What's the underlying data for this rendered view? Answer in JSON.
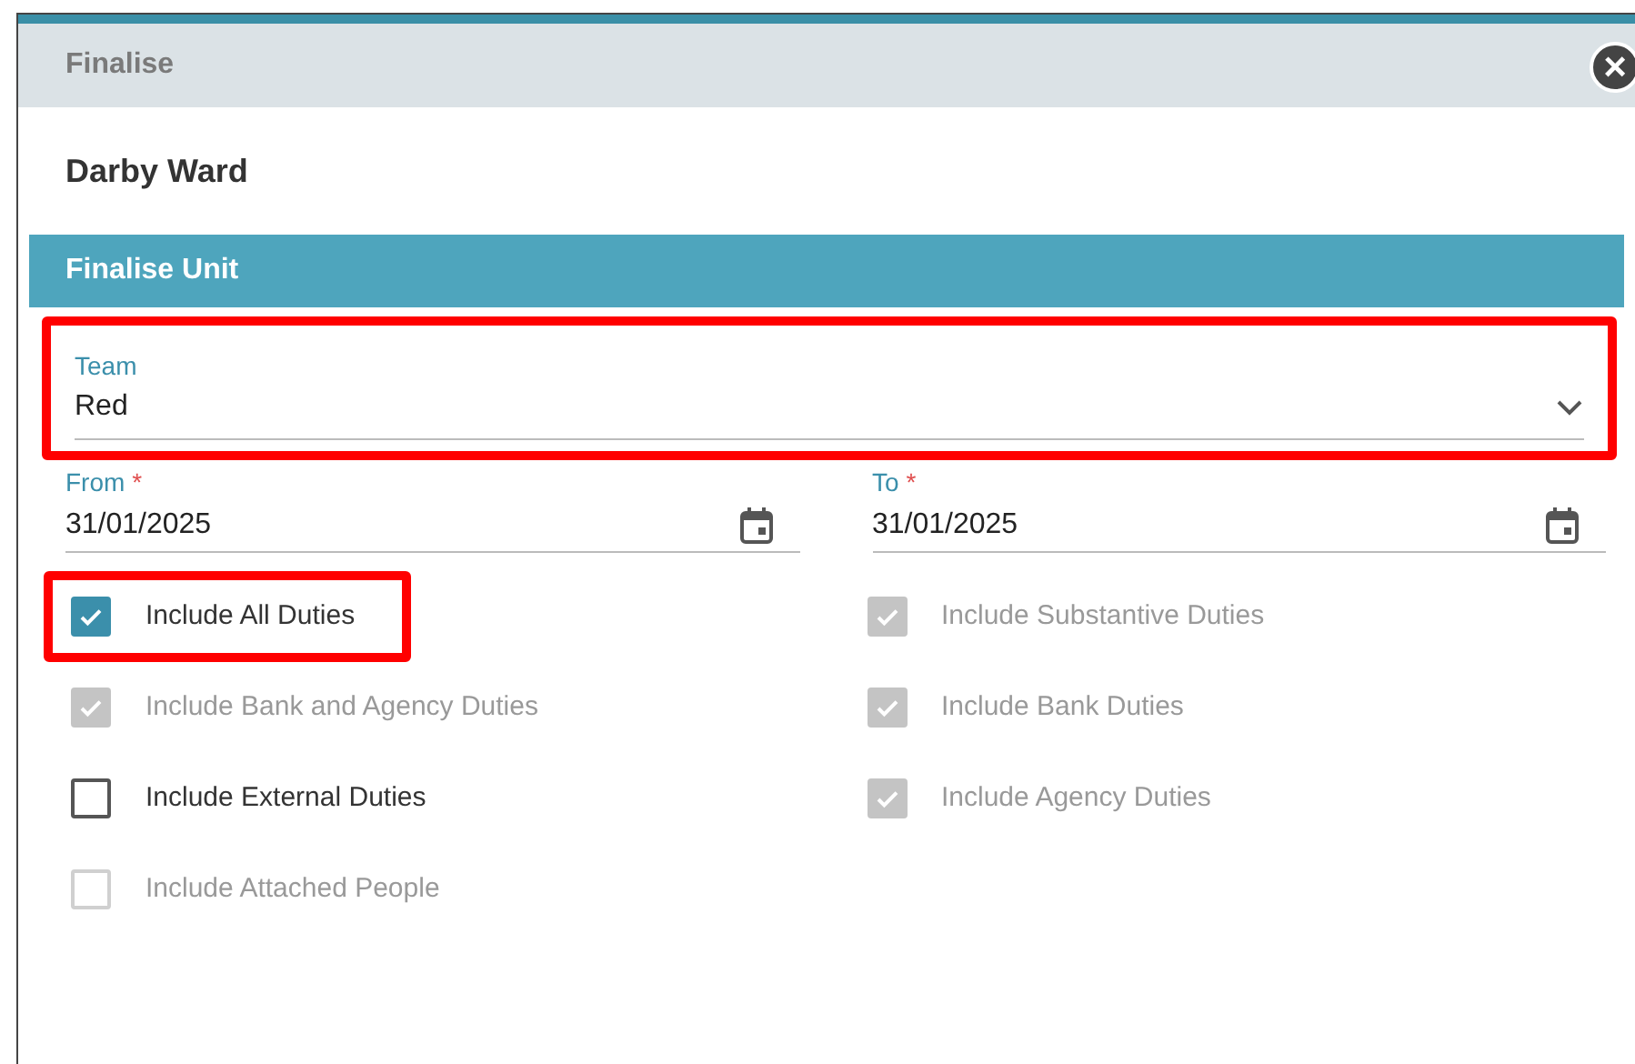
{
  "dialog": {
    "title": "Finalise",
    "close_label": "×"
  },
  "unit_name": "Darby Ward",
  "section": {
    "title": "Finalise Unit"
  },
  "team": {
    "label": "Team",
    "value": "Red",
    "highlighted": true
  },
  "dates": [
    {
      "label": "From",
      "required_mark": "*",
      "value": "31/01/2025"
    },
    {
      "label": "To",
      "required_mark": "*",
      "value": "31/01/2025"
    }
  ],
  "options": [
    {
      "label": "Include All Duties",
      "checked": true,
      "disabled": false,
      "highlighted": true
    },
    {
      "label": "Include Substantive Duties",
      "checked": true,
      "disabled": true,
      "highlighted": false
    },
    {
      "label": "Include Bank and Agency Duties",
      "checked": true,
      "disabled": true,
      "highlighted": false
    },
    {
      "label": "Include Bank Duties",
      "checked": true,
      "disabled": true,
      "highlighted": false
    },
    {
      "label": "Include External Duties",
      "checked": false,
      "disabled": false,
      "highlighted": false
    },
    {
      "label": "Include Agency Duties",
      "checked": true,
      "disabled": true,
      "highlighted": false
    },
    {
      "label": "Include Attached People",
      "checked": false,
      "disabled": true,
      "highlighted": false
    }
  ]
}
